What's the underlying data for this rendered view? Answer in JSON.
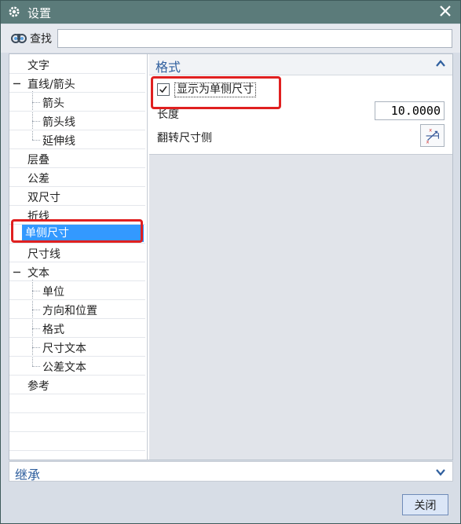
{
  "window": {
    "title": "设置"
  },
  "search": {
    "label": "查找",
    "value": "",
    "placeholder": ""
  },
  "tree": {
    "items": [
      {
        "label": "文字",
        "level": 0,
        "expander": "",
        "selected": false
      },
      {
        "label": "直线/箭头",
        "level": 0,
        "expander": "minus",
        "selected": false
      },
      {
        "label": "箭头",
        "level": 1,
        "expander": "",
        "selected": false
      },
      {
        "label": "箭头线",
        "level": 1,
        "expander": "",
        "selected": false
      },
      {
        "label": "延伸线",
        "level": 1,
        "expander": "",
        "selected": false
      },
      {
        "label": "层叠",
        "level": 0,
        "expander": "",
        "selected": false
      },
      {
        "label": "公差",
        "level": 0,
        "expander": "",
        "selected": false
      },
      {
        "label": "双尺寸",
        "level": 0,
        "expander": "",
        "selected": false
      },
      {
        "label": "折线",
        "level": 0,
        "expander": "",
        "selected": false
      },
      {
        "label": "单侧尺寸",
        "level": 0,
        "expander": "",
        "selected": true
      },
      {
        "label": "尺寸线",
        "level": 0,
        "expander": "",
        "selected": false
      },
      {
        "label": "文本",
        "level": 0,
        "expander": "minus",
        "selected": false
      },
      {
        "label": "单位",
        "level": 1,
        "expander": "",
        "selected": false
      },
      {
        "label": "方向和位置",
        "level": 1,
        "expander": "",
        "selected": false
      },
      {
        "label": "格式",
        "level": 1,
        "expander": "",
        "selected": false
      },
      {
        "label": "尺寸文本",
        "level": 1,
        "expander": "",
        "selected": false
      },
      {
        "label": "公差文本",
        "level": 1,
        "expander": "",
        "selected": false
      },
      {
        "label": "参考",
        "level": 0,
        "expander": "",
        "selected": false
      }
    ]
  },
  "format_section": {
    "title": "格式",
    "checkbox_label": "显示为单侧尺寸",
    "checkbox_checked": true,
    "length_label": "长度",
    "length_value": "10.0000",
    "flip_label": "翻转尺寸侧"
  },
  "inherit_section": {
    "title": "继承"
  },
  "buttons": {
    "close_label": "关闭"
  },
  "colors": {
    "titlebar": "#5b7b7a",
    "selection": "#3399ff",
    "section_title": "#2f5f9e",
    "highlight": "#e02020"
  },
  "icons": [
    "gear-icon",
    "close-icon",
    "search-icon",
    "collapse-up-icon",
    "expand-down-icon",
    "flip-side-icon",
    "checkmark-icon"
  ]
}
